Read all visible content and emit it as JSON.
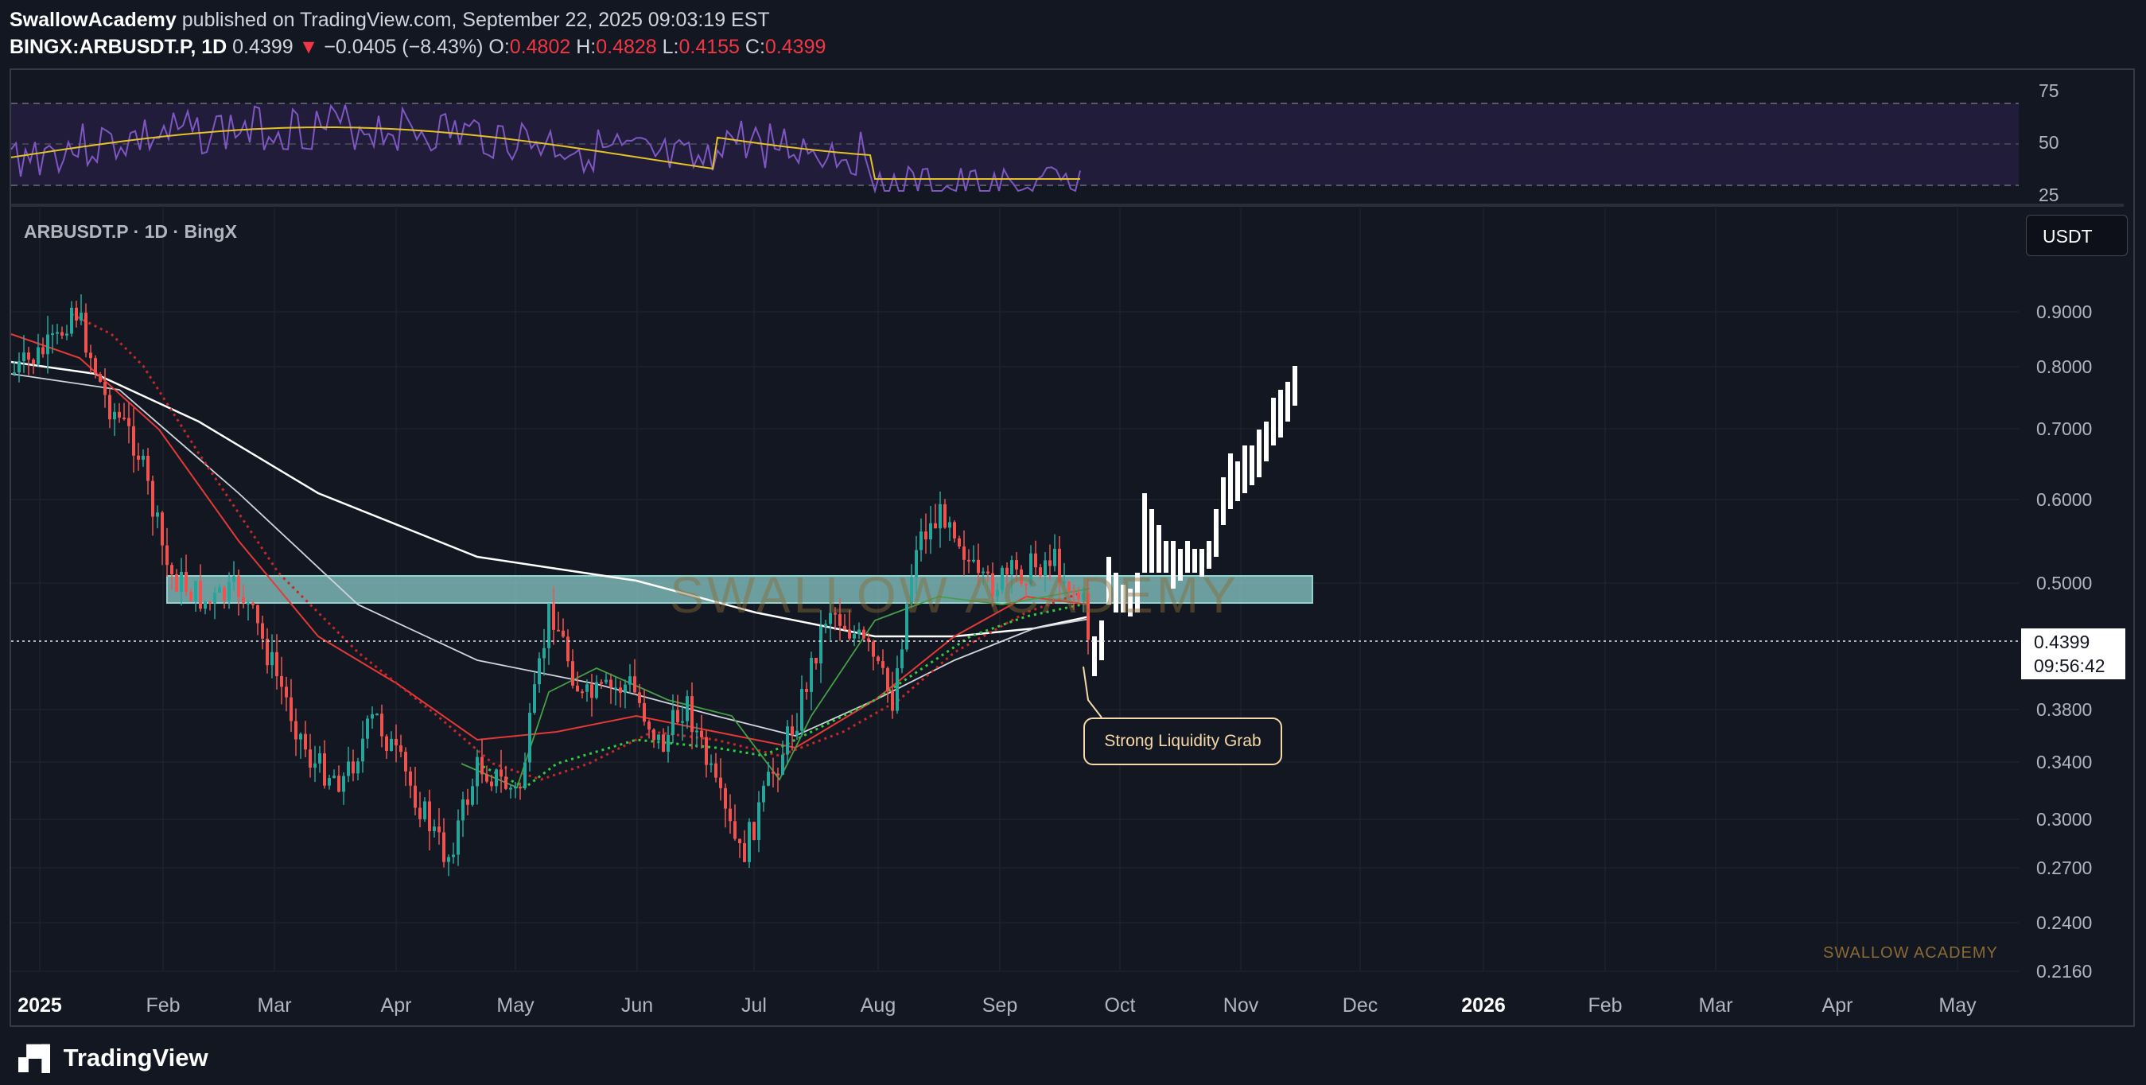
{
  "header": {
    "author": "SwallowAcademy",
    "published": "published on TradingView.com, September 22, 2025 09:03:19 EST",
    "symbol": "BINGX:ARBUSDT.P, 1D",
    "last": "0.4399",
    "change_arrow": "▼",
    "change": "−0.0405 (−8.43%)",
    "o_label": "O:",
    "o": "0.4802",
    "h_label": "H:",
    "h": "0.4828",
    "l_label": "L:",
    "l": "0.4155",
    "c_label": "C:",
    "c": "0.4399"
  },
  "chart": {
    "legend": "ARBUSDT.P · 1D · BingX",
    "currency_button": "USDT",
    "current_price": "0.4399",
    "countdown": "09:56:42",
    "callout": "Strong Liquidity Grab",
    "watermark": "SWALLOW ACADEMY",
    "watermark_small": "SWALLOW ACADEMY",
    "price_axis": [
      "0.9000",
      "0.8000",
      "0.7000",
      "0.6000",
      "0.5000",
      "0.3800",
      "0.3400",
      "0.3000",
      "0.2700",
      "0.2400",
      "0.2160"
    ],
    "time_axis": [
      "2025",
      "Feb",
      "Mar",
      "Apr",
      "May",
      "Jun",
      "Jul",
      "Aug",
      "Sep",
      "Oct",
      "Nov",
      "Dec",
      "2026",
      "Feb",
      "Mar",
      "Apr",
      "May"
    ],
    "rsi_axis": [
      "75",
      "50",
      "25"
    ],
    "colors": {
      "up": "#26a69a",
      "down": "#ef5350",
      "zone": "#8fd3d0",
      "rsi": "#7e57c2",
      "rsi_ma": "#e6c229",
      "projection": "#ffffff"
    }
  },
  "footer": {
    "brand": "TradingView",
    "logo_icon": "tradingview-logo-icon"
  }
}
